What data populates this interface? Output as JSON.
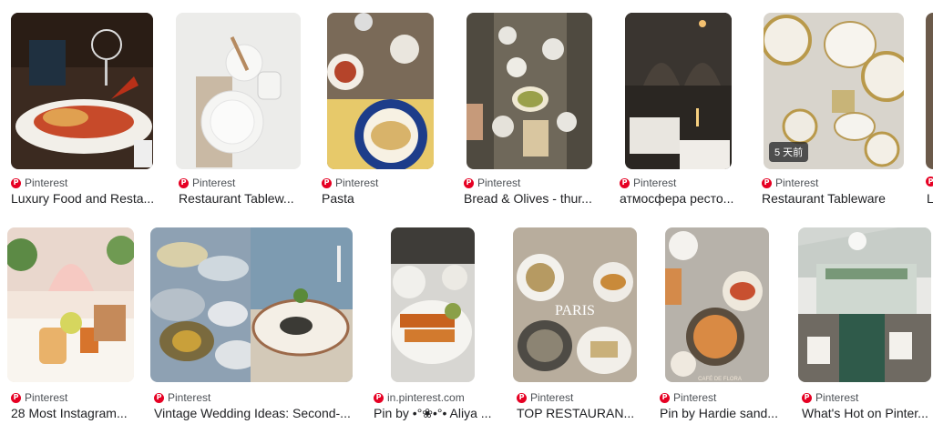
{
  "results": [
    {
      "source": "Pinterest",
      "title": "Luxury Food and Resta..."
    },
    {
      "source": "Pinterest",
      "title": "Restaurant Tablew..."
    },
    {
      "source": "Pinterest",
      "title": "Pasta"
    },
    {
      "source": "Pinterest",
      "title": "Bread & Olives - thur..."
    },
    {
      "source": "Pinterest",
      "title": "атмосфера ресто..."
    },
    {
      "source": "Pinterest",
      "title": "Restaurant Tableware",
      "badge": "5 天前"
    },
    {
      "source": "",
      "title": "L"
    },
    {
      "source": "Pinterest",
      "title": "28 Most Instagram..."
    },
    {
      "source": "Pinterest",
      "title": "Vintage Wedding Ideas: Second-..."
    },
    {
      "source": "in.pinterest.com",
      "title": "Pin by •°❀•°• Aliya ..."
    },
    {
      "source": "Pinterest",
      "title": "TOP RESTAURAN..."
    },
    {
      "source": "Pinterest",
      "title": "Pin by Hardie sand..."
    },
    {
      "source": "Pinterest",
      "title": "What's Hot on Pinter..."
    }
  ],
  "image_overlays": {
    "paris_text": "PARIS",
    "cafe_text": "CAFÉ DE FLORA"
  },
  "colors": {
    "pinterest_red": "#e60023"
  }
}
